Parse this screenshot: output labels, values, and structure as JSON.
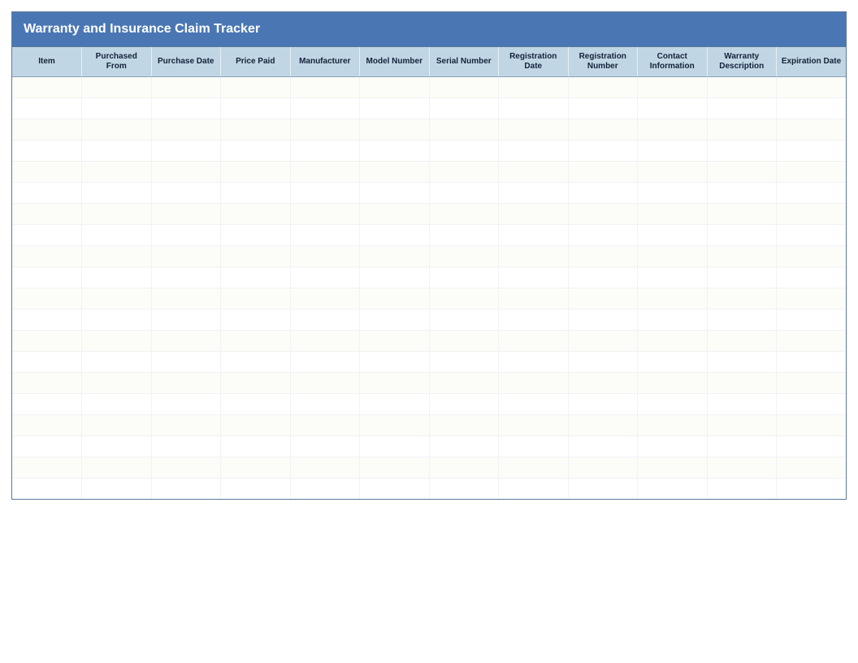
{
  "title": "Warranty and Insurance Claim Tracker",
  "columns": [
    "Item",
    "Purchased From",
    "Purchase Date",
    "Price Paid",
    "Manufacturer",
    "Model Number",
    "Serial Number",
    "Registration Date",
    "Registration Number",
    "Contact Information",
    "Warranty Description",
    "Expiration Date"
  ],
  "rows": [
    [
      "",
      "",
      "",
      "",
      "",
      "",
      "",
      "",
      "",
      "",
      "",
      ""
    ],
    [
      "",
      "",
      "",
      "",
      "",
      "",
      "",
      "",
      "",
      "",
      "",
      ""
    ],
    [
      "",
      "",
      "",
      "",
      "",
      "",
      "",
      "",
      "",
      "",
      "",
      ""
    ],
    [
      "",
      "",
      "",
      "",
      "",
      "",
      "",
      "",
      "",
      "",
      "",
      ""
    ],
    [
      "",
      "",
      "",
      "",
      "",
      "",
      "",
      "",
      "",
      "",
      "",
      ""
    ],
    [
      "",
      "",
      "",
      "",
      "",
      "",
      "",
      "",
      "",
      "",
      "",
      ""
    ],
    [
      "",
      "",
      "",
      "",
      "",
      "",
      "",
      "",
      "",
      "",
      "",
      ""
    ],
    [
      "",
      "",
      "",
      "",
      "",
      "",
      "",
      "",
      "",
      "",
      "",
      ""
    ],
    [
      "",
      "",
      "",
      "",
      "",
      "",
      "",
      "",
      "",
      "",
      "",
      ""
    ],
    [
      "",
      "",
      "",
      "",
      "",
      "",
      "",
      "",
      "",
      "",
      "",
      ""
    ],
    [
      "",
      "",
      "",
      "",
      "",
      "",
      "",
      "",
      "",
      "",
      "",
      ""
    ],
    [
      "",
      "",
      "",
      "",
      "",
      "",
      "",
      "",
      "",
      "",
      "",
      ""
    ],
    [
      "",
      "",
      "",
      "",
      "",
      "",
      "",
      "",
      "",
      "",
      "",
      ""
    ],
    [
      "",
      "",
      "",
      "",
      "",
      "",
      "",
      "",
      "",
      "",
      "",
      ""
    ],
    [
      "",
      "",
      "",
      "",
      "",
      "",
      "",
      "",
      "",
      "",
      "",
      ""
    ],
    [
      "",
      "",
      "",
      "",
      "",
      "",
      "",
      "",
      "",
      "",
      "",
      ""
    ],
    [
      "",
      "",
      "",
      "",
      "",
      "",
      "",
      "",
      "",
      "",
      "",
      ""
    ],
    [
      "",
      "",
      "",
      "",
      "",
      "",
      "",
      "",
      "",
      "",
      "",
      ""
    ],
    [
      "",
      "",
      "",
      "",
      "",
      "",
      "",
      "",
      "",
      "",
      "",
      ""
    ],
    [
      "",
      "",
      "",
      "",
      "",
      "",
      "",
      "",
      "",
      "",
      "",
      ""
    ]
  ]
}
